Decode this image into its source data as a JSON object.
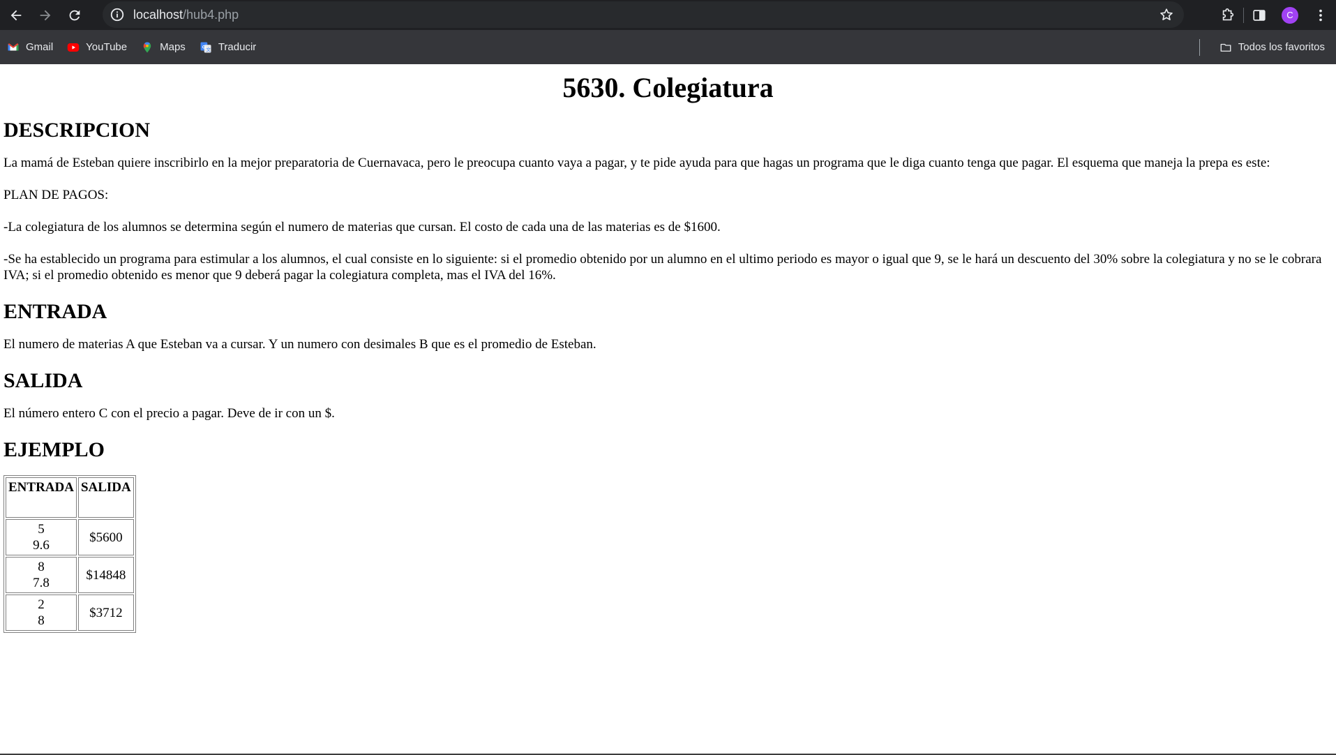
{
  "browser": {
    "url_host": "localhost",
    "url_path": "/hub4.php",
    "profile_initial": "C",
    "bookmarks": [
      {
        "label": "Gmail",
        "icon": "gmail-icon"
      },
      {
        "label": "YouTube",
        "icon": "youtube-icon"
      },
      {
        "label": "Maps",
        "icon": "maps-icon"
      },
      {
        "label": "Traducir",
        "icon": "translate-icon"
      }
    ],
    "all_bookmarks_label": "Todos los favoritos"
  },
  "page": {
    "title": "5630. Colegiatura",
    "description": {
      "heading": "DESCRIPCION",
      "intro": "La mamá de Esteban quiere inscribirlo en la mejor preparatoria de Cuernavaca, pero le preocupa cuanto vaya a pagar, y te pide ayuda para que hagas un programa que le diga cuanto tenga que pagar. El esquema que maneja la prepa es este:",
      "plan": "PLAN DE PAGOS:",
      "cost_rule": "-La colegiatura de los alumnos se determina según el numero de materias que cursan. El costo de cada una de las materias es de $1600.",
      "discount_rule": "-Se ha establecido un programa para estimular a los alumnos, el cual consiste en lo siguiente: si el promedio obtenido por un alumno en el ultimo periodo es mayor o igual que 9, se le hará un descuento del 30% sobre la colegiatura y no se le cobrara IVA; si el promedio obtenido es menor que 9 deberá pagar la colegiatura completa, mas el IVA del 16%."
    },
    "input": {
      "heading": "ENTRADA",
      "text": "El numero de materias A que Esteban va a cursar. Y un numero con desimales B que es el promedio de Esteban."
    },
    "output": {
      "heading": "SALIDA",
      "text": "El número entero C con el precio a pagar. Deve de ir con un $."
    },
    "example": {
      "heading": "EJEMPLO",
      "columns": [
        "ENTRADA",
        "SALIDA"
      ],
      "rows": [
        {
          "input_a": "5",
          "input_b": "9.6",
          "output": "$5600"
        },
        {
          "input_a": "8",
          "input_b": "7.8",
          "output": "$14848"
        },
        {
          "input_a": "2",
          "input_b": "8",
          "output": "$3712"
        }
      ]
    }
  }
}
